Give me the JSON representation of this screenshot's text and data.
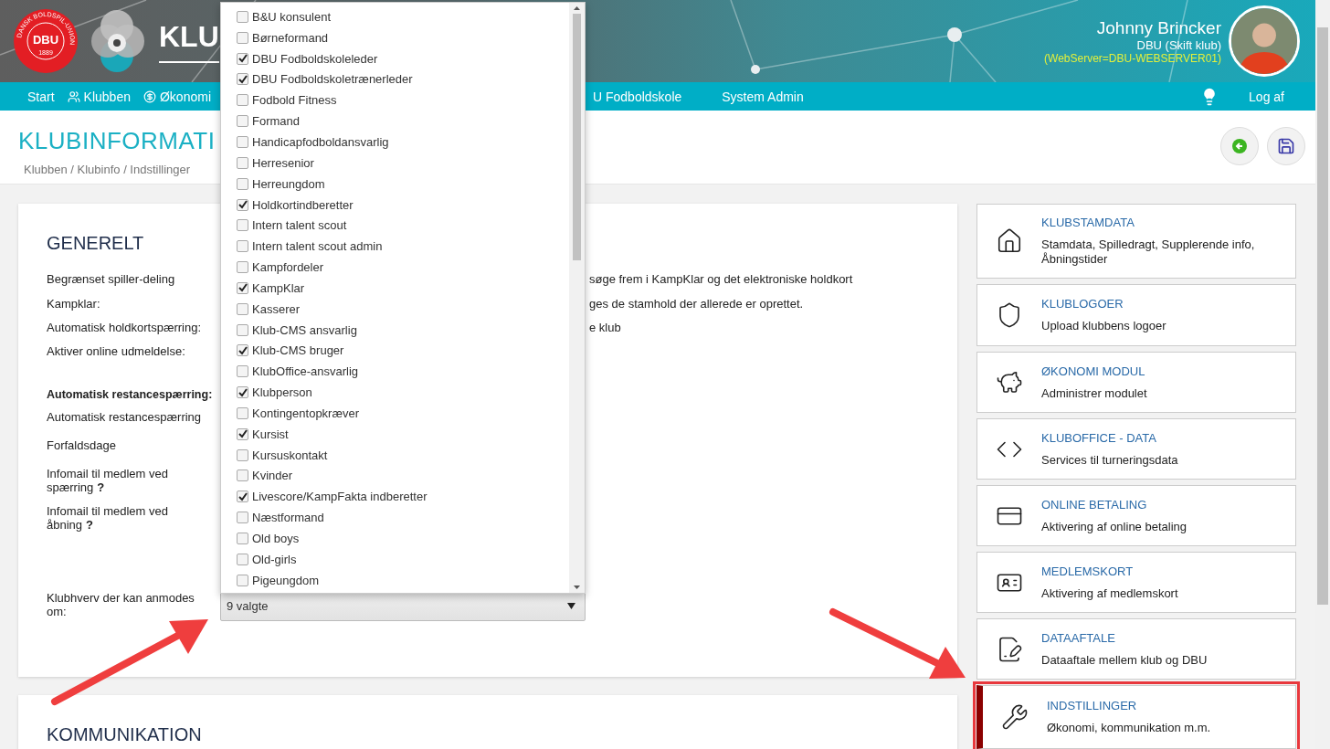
{
  "header": {
    "logo_text": "DBU",
    "logo_ring": "DANSK BOLDSPIL-UNION",
    "logo_year": "1889",
    "app_title": "KLU",
    "user": {
      "name": "Johnny Brincker",
      "club": "DBU",
      "club_link": "(Skift klub)",
      "server": "(WebServer=DBU-WEBSERVER01)"
    }
  },
  "nav": {
    "items": [
      {
        "label": "Start"
      },
      {
        "label": "Klubben"
      },
      {
        "label": "Økonomi"
      }
    ],
    "items_after": [
      {
        "label": "U Fodboldskole"
      },
      {
        "label": "System Admin"
      }
    ],
    "right_link": "Log af"
  },
  "page": {
    "title": "KLUBINFORMATI",
    "breadcrumb": "Klubben / Klubinfo / Indstillinger"
  },
  "general": {
    "heading": "GENERELT",
    "rows": [
      {
        "label": "Begrænset spiller-deling",
        "bold": false,
        "value": "søge frem i KampKlar og det elektroniske holdkort"
      },
      {
        "label": "Kampklar:",
        "bold": false,
        "value": "ges de stamhold der allerede er oprettet."
      },
      {
        "label": "Automatisk holdkortspærring:",
        "bold": false,
        "value": "e klub"
      },
      {
        "label": "Aktiver online udmeldelse:",
        "bold": false
      },
      {
        "label": "Automatisk restancespærring:",
        "bold": true
      },
      {
        "label": "Automatisk restancespærring",
        "bold": false
      },
      {
        "label": "Forfaldsdage",
        "bold": false
      },
      {
        "label": "Infomail til medlem ved spærring",
        "bold": false,
        "help": "?"
      },
      {
        "label": "Infomail til medlem ved åbning",
        "bold": false,
        "help": "?"
      }
    ],
    "select_row": {
      "label": "Klubhverv der kan anmodes om:",
      "value": "9 valgte"
    }
  },
  "dropdown": {
    "options": [
      {
        "label": "B&U konsulent",
        "checked": false
      },
      {
        "label": "Børneformand",
        "checked": false
      },
      {
        "label": "DBU Fodboldskoleleder",
        "checked": true
      },
      {
        "label": "DBU Fodboldskoletrænerleder",
        "checked": true
      },
      {
        "label": "Fodbold Fitness",
        "checked": false
      },
      {
        "label": "Formand",
        "checked": false
      },
      {
        "label": "Handicapfodboldansvarlig",
        "checked": false
      },
      {
        "label": "Herresenior",
        "checked": false
      },
      {
        "label": "Herreungdom",
        "checked": false
      },
      {
        "label": "Holdkortindberetter",
        "checked": true
      },
      {
        "label": "Intern talent scout",
        "checked": false
      },
      {
        "label": "Intern talent scout admin",
        "checked": false
      },
      {
        "label": "Kampfordeler",
        "checked": false
      },
      {
        "label": "KampKlar",
        "checked": true
      },
      {
        "label": "Kasserer",
        "checked": false
      },
      {
        "label": "Klub-CMS ansvarlig",
        "checked": false
      },
      {
        "label": "Klub-CMS bruger",
        "checked": true
      },
      {
        "label": "KlubOffice-ansvarlig",
        "checked": false
      },
      {
        "label": "Klubperson",
        "checked": true
      },
      {
        "label": "Kontingentopkræver",
        "checked": false
      },
      {
        "label": "Kursist",
        "checked": true
      },
      {
        "label": "Kursuskontakt",
        "checked": false
      },
      {
        "label": "Kvinder",
        "checked": false
      },
      {
        "label": "Livescore/KampFakta indberetter",
        "checked": true
      },
      {
        "label": "Næstformand",
        "checked": false
      },
      {
        "label": "Old boys",
        "checked": false
      },
      {
        "label": "Old-girls",
        "checked": false
      },
      {
        "label": "Pigeungdom",
        "checked": false
      }
    ]
  },
  "communication": {
    "heading": "KOMMUNIKATION"
  },
  "side_cards": [
    {
      "title": "KLUBSTAMDATA",
      "subtitle": "Stamdata, Spilledragt, Supplerende info, Åbningstider",
      "selected": false
    },
    {
      "title": "KLUBLOGOER",
      "subtitle": "Upload klubbens logoer",
      "selected": false
    },
    {
      "title": "ØKONOMI MODUL",
      "subtitle": "Administrer modulet",
      "selected": false
    },
    {
      "title": "KLUBOFFICE - DATA",
      "subtitle": "Services til turneringsdata",
      "selected": false
    },
    {
      "title": "ONLINE BETALING",
      "subtitle": "Aktivering af online betaling",
      "selected": false
    },
    {
      "title": "MEDLEMSKORT",
      "subtitle": "Aktivering af medlemskort",
      "selected": false
    },
    {
      "title": "DATAAFTALE",
      "subtitle": "Dataaftale mellem klub og DBU",
      "selected": false
    },
    {
      "title": "INDSTILLINGER",
      "subtitle": "Økonomi, kommunikation m.m.",
      "selected": true
    }
  ]
}
